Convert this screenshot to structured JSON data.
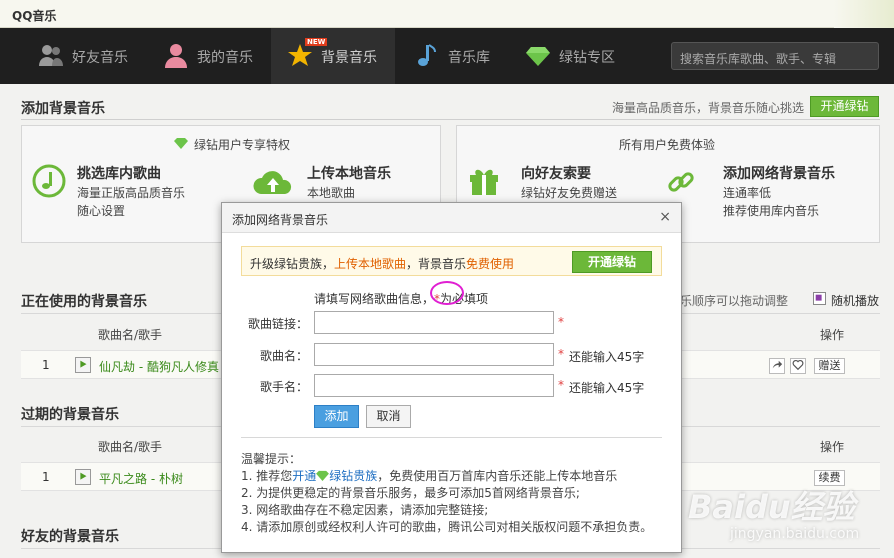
{
  "app": {
    "title": "QQ音乐"
  },
  "nav": {
    "items": [
      {
        "label": "好友音乐",
        "icon": "friends-icon"
      },
      {
        "label": "我的音乐",
        "icon": "user-icon"
      },
      {
        "label": "背景音乐",
        "icon": "star-icon",
        "badge": "NEW",
        "active": true
      },
      {
        "label": "音乐库",
        "icon": "music-note-icon"
      },
      {
        "label": "绿钻专区",
        "icon": "diamond-icon"
      }
    ],
    "search_placeholder": "搜索音乐库歌曲、歌手、专辑"
  },
  "add_section": {
    "title": "添加背景音乐",
    "slogan": "海量高品质音乐，背景音乐随心挑选",
    "open_button": "开通绿钻",
    "vip_box": {
      "header": "绿钻用户专享特权",
      "features": [
        {
          "title": "挑选库内歌曲",
          "lines": [
            "海量正版高品质音乐",
            "随心设置"
          ]
        },
        {
          "title": "上传本地音乐",
          "lines": [
            "本地歌曲"
          ]
        }
      ]
    },
    "free_box": {
      "header": "所有用户免费体验",
      "features": [
        {
          "title": "向好友索要",
          "lines": [
            "绿钻好友免费赠送"
          ]
        },
        {
          "title": "添加网络背景音乐",
          "lines": [
            "连通率低",
            "推荐使用库内音乐"
          ]
        }
      ]
    }
  },
  "current_section": {
    "title": "正在使用的背景音乐",
    "drag_hint": "乐顺序可以拖动调整",
    "shuffle_label": "随机播放",
    "col_song": "歌曲名/歌手",
    "col_action": "操作",
    "rows": [
      {
        "index": "1",
        "song": "仙凡劫 - 酷狗凡人修真",
        "action": "赠送"
      }
    ]
  },
  "expired_section": {
    "title": "过期的背景音乐",
    "col_song": "歌曲名/歌手",
    "col_action": "操作",
    "rows": [
      {
        "index": "1",
        "song": "平凡之路 - 朴树",
        "action": "续费"
      }
    ]
  },
  "friends_section": {
    "title": "好友的背景音乐"
  },
  "dialog": {
    "title": "添加网络背景音乐",
    "close": "×",
    "promo": {
      "prefix": "升级绿钻贵族，",
      "link1": "上传本地歌曲",
      "middle": "，背景音乐",
      "link2": "免费使用",
      "button": "开通绿钻"
    },
    "instruction_prefix": "请填写网络歌曲信息，",
    "required_mark": "*",
    "instruction_suffix": "为必填项",
    "fields": [
      {
        "label": "歌曲链接：",
        "value": "",
        "hint": ""
      },
      {
        "label": "歌曲名：",
        "value": "",
        "hint": "还能输入45字"
      },
      {
        "label": "歌手名：",
        "value": "",
        "hint": "还能输入45字"
      }
    ],
    "add_button": "添加",
    "cancel_button": "取消",
    "tips_title": "温馨提示：",
    "tips": [
      {
        "prefix": "1. 推荐您",
        "link1": "开通",
        "link2": "绿钻贵族",
        "suffix": "，免费使用百万首库内音乐还能上传本地音乐"
      },
      {
        "text": "2. 为提供更稳定的背景音乐服务，最多可添加5首网络背景音乐;"
      },
      {
        "text": "3. 网络歌曲存在不稳定因素，请添加完整链接;"
      },
      {
        "text": "4. 请添加原创或经权利人许可的歌曲，腾讯公司对相关版权问题不承担负责。"
      }
    ]
  },
  "watermark": {
    "brand": "Baidu经验",
    "url": "jingyan.baidu.com"
  },
  "colors": {
    "accent_green": "#6cb839",
    "link_orange": "#e06000",
    "highlight_circle": "#e01fd2"
  }
}
